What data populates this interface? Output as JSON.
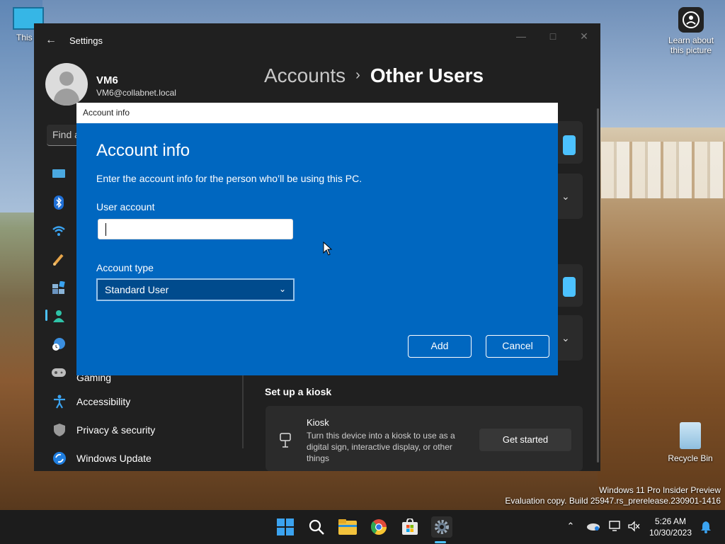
{
  "desktop": {
    "this_pc_label": "This P",
    "learn_label": "Learn about this picture",
    "recycle_label": "Recycle Bin",
    "watermark_line1": "Windows 11 Pro Insider Preview",
    "watermark_line2": "Evaluation copy. Build 25947.rs_prerelease.230901-1416"
  },
  "settings": {
    "app_title": "Settings",
    "user": {
      "name": "VM6",
      "email": "VM6@collabnet.local"
    },
    "search_placeholder": "Find a",
    "breadcrumb": {
      "parent": "Accounts",
      "separator": "›",
      "current": "Other Users"
    },
    "nav": [
      {
        "label": "Gaming",
        "icon": "gaming-icon"
      },
      {
        "label": "Accessibility",
        "icon": "accessibility-icon"
      },
      {
        "label": "Privacy & security",
        "icon": "shield-icon"
      },
      {
        "label": "Windows Update",
        "icon": "update-icon"
      }
    ],
    "kiosk": {
      "section_title": "Set up a kiosk",
      "title": "Kiosk",
      "description": "Turn this device into a kiosk to use as a digital sign, interactive display, or other things",
      "button": "Get started"
    }
  },
  "dialog": {
    "titlebar": "Account info",
    "heading": "Account info",
    "description": "Enter the account info for the person who’ll be using this PC.",
    "user_account_label": "User account",
    "user_account_value": "",
    "account_type_label": "Account type",
    "account_type_value": "Standard User",
    "add_button": "Add",
    "cancel_button": "Cancel"
  },
  "taskbar": {
    "time": "5:26 AM",
    "date": "10/30/2023"
  },
  "colors": {
    "accent": "#4cc2ff",
    "dialog_bg": "#0067c0",
    "window_bg": "#202020"
  }
}
